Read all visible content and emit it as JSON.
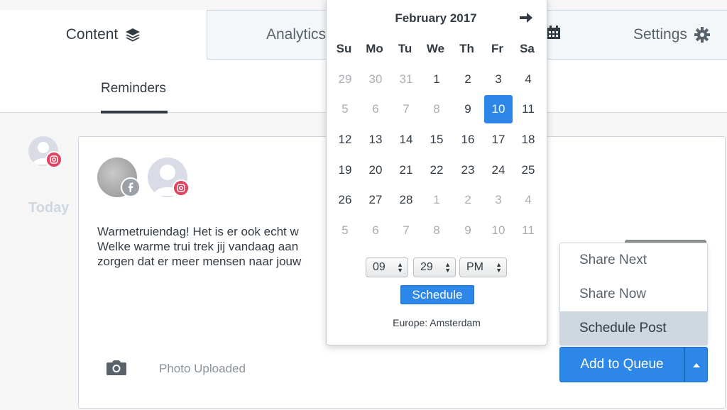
{
  "tabs": [
    {
      "label": "Content",
      "icon": "layers-icon"
    },
    {
      "label": "Analytics",
      "icon": "chart-icon"
    },
    {
      "label": "",
      "icon": "calendar-icon"
    },
    {
      "label": "Settings",
      "icon": "gear-icon"
    }
  ],
  "subnav": {
    "active": "Reminders"
  },
  "feed": {
    "day_label": "Today",
    "post_text_lines": [
      "Warmetruiendag! Het is er ook echt w",
      "Welke warme trui trek jij vandaag aan",
      "zorgen dat er meer mensen naar jouw"
    ],
    "photo_status": "Photo Uploaded"
  },
  "calendar": {
    "month": "February 2017",
    "weekdays": [
      "Su",
      "Mo",
      "Tu",
      "We",
      "Th",
      "Fr",
      "Sa"
    ],
    "weeks": [
      [
        "29",
        "30",
        "31",
        "1",
        "2",
        "3",
        "4"
      ],
      [
        "5",
        "6",
        "7",
        "8",
        "9",
        "10",
        "11"
      ],
      [
        "12",
        "13",
        "14",
        "15",
        "16",
        "17",
        "18"
      ],
      [
        "19",
        "20",
        "21",
        "22",
        "23",
        "24",
        "25"
      ],
      [
        "26",
        "27",
        "28",
        "1",
        "2",
        "3",
        "4"
      ],
      [
        "5",
        "6",
        "7",
        "8",
        "9",
        "10",
        "11"
      ]
    ],
    "selected_day": "10",
    "hour": "09",
    "minute": "29",
    "ampm": "PM",
    "schedule_label": "Schedule",
    "timezone": "Europe: Amsterdam"
  },
  "post_menu": {
    "items": [
      "Share Next",
      "Share Now",
      "Schedule Post"
    ],
    "selected": "Schedule Post"
  },
  "queue_button": {
    "label": "Add to Queue"
  },
  "colors": {
    "accent": "#2c87e8",
    "instagram": "#e4405f",
    "border": "#ced7df"
  }
}
